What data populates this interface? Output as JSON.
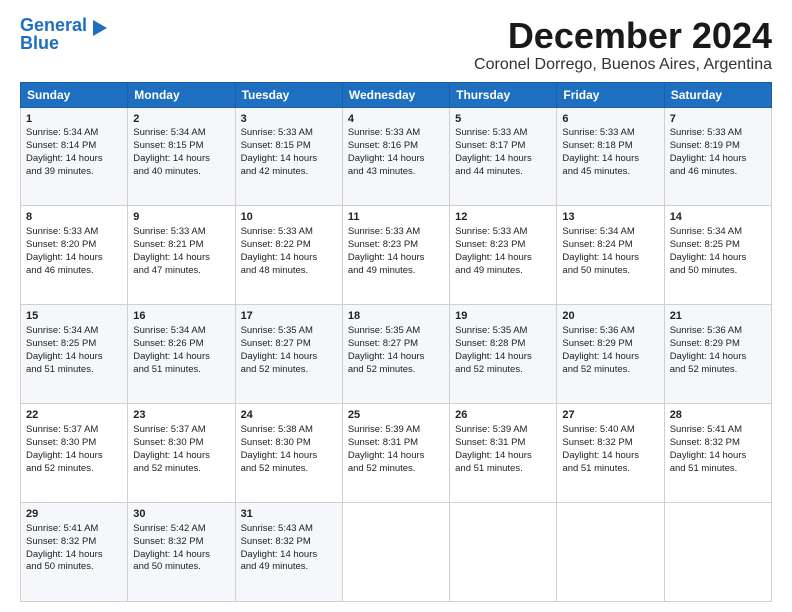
{
  "logo": {
    "line1": "General",
    "line2": "Blue"
  },
  "title": "December 2024",
  "location": "Coronel Dorrego, Buenos Aires, Argentina",
  "weekdays": [
    "Sunday",
    "Monday",
    "Tuesday",
    "Wednesday",
    "Thursday",
    "Friday",
    "Saturday"
  ],
  "weeks": [
    [
      {
        "day": "1",
        "lines": [
          "Sunrise: 5:34 AM",
          "Sunset: 8:14 PM",
          "Daylight: 14 hours",
          "and 39 minutes."
        ]
      },
      {
        "day": "2",
        "lines": [
          "Sunrise: 5:34 AM",
          "Sunset: 8:15 PM",
          "Daylight: 14 hours",
          "and 40 minutes."
        ]
      },
      {
        "day": "3",
        "lines": [
          "Sunrise: 5:33 AM",
          "Sunset: 8:15 PM",
          "Daylight: 14 hours",
          "and 42 minutes."
        ]
      },
      {
        "day": "4",
        "lines": [
          "Sunrise: 5:33 AM",
          "Sunset: 8:16 PM",
          "Daylight: 14 hours",
          "and 43 minutes."
        ]
      },
      {
        "day": "5",
        "lines": [
          "Sunrise: 5:33 AM",
          "Sunset: 8:17 PM",
          "Daylight: 14 hours",
          "and 44 minutes."
        ]
      },
      {
        "day": "6",
        "lines": [
          "Sunrise: 5:33 AM",
          "Sunset: 8:18 PM",
          "Daylight: 14 hours",
          "and 45 minutes."
        ]
      },
      {
        "day": "7",
        "lines": [
          "Sunrise: 5:33 AM",
          "Sunset: 8:19 PM",
          "Daylight: 14 hours",
          "and 46 minutes."
        ]
      }
    ],
    [
      {
        "day": "8",
        "lines": [
          "Sunrise: 5:33 AM",
          "Sunset: 8:20 PM",
          "Daylight: 14 hours",
          "and 46 minutes."
        ]
      },
      {
        "day": "9",
        "lines": [
          "Sunrise: 5:33 AM",
          "Sunset: 8:21 PM",
          "Daylight: 14 hours",
          "and 47 minutes."
        ]
      },
      {
        "day": "10",
        "lines": [
          "Sunrise: 5:33 AM",
          "Sunset: 8:22 PM",
          "Daylight: 14 hours",
          "and 48 minutes."
        ]
      },
      {
        "day": "11",
        "lines": [
          "Sunrise: 5:33 AM",
          "Sunset: 8:23 PM",
          "Daylight: 14 hours",
          "and 49 minutes."
        ]
      },
      {
        "day": "12",
        "lines": [
          "Sunrise: 5:33 AM",
          "Sunset: 8:23 PM",
          "Daylight: 14 hours",
          "and 49 minutes."
        ]
      },
      {
        "day": "13",
        "lines": [
          "Sunrise: 5:34 AM",
          "Sunset: 8:24 PM",
          "Daylight: 14 hours",
          "and 50 minutes."
        ]
      },
      {
        "day": "14",
        "lines": [
          "Sunrise: 5:34 AM",
          "Sunset: 8:25 PM",
          "Daylight: 14 hours",
          "and 50 minutes."
        ]
      }
    ],
    [
      {
        "day": "15",
        "lines": [
          "Sunrise: 5:34 AM",
          "Sunset: 8:25 PM",
          "Daylight: 14 hours",
          "and 51 minutes."
        ]
      },
      {
        "day": "16",
        "lines": [
          "Sunrise: 5:34 AM",
          "Sunset: 8:26 PM",
          "Daylight: 14 hours",
          "and 51 minutes."
        ]
      },
      {
        "day": "17",
        "lines": [
          "Sunrise: 5:35 AM",
          "Sunset: 8:27 PM",
          "Daylight: 14 hours",
          "and 52 minutes."
        ]
      },
      {
        "day": "18",
        "lines": [
          "Sunrise: 5:35 AM",
          "Sunset: 8:27 PM",
          "Daylight: 14 hours",
          "and 52 minutes."
        ]
      },
      {
        "day": "19",
        "lines": [
          "Sunrise: 5:35 AM",
          "Sunset: 8:28 PM",
          "Daylight: 14 hours",
          "and 52 minutes."
        ]
      },
      {
        "day": "20",
        "lines": [
          "Sunrise: 5:36 AM",
          "Sunset: 8:29 PM",
          "Daylight: 14 hours",
          "and 52 minutes."
        ]
      },
      {
        "day": "21",
        "lines": [
          "Sunrise: 5:36 AM",
          "Sunset: 8:29 PM",
          "Daylight: 14 hours",
          "and 52 minutes."
        ]
      }
    ],
    [
      {
        "day": "22",
        "lines": [
          "Sunrise: 5:37 AM",
          "Sunset: 8:30 PM",
          "Daylight: 14 hours",
          "and 52 minutes."
        ]
      },
      {
        "day": "23",
        "lines": [
          "Sunrise: 5:37 AM",
          "Sunset: 8:30 PM",
          "Daylight: 14 hours",
          "and 52 minutes."
        ]
      },
      {
        "day": "24",
        "lines": [
          "Sunrise: 5:38 AM",
          "Sunset: 8:30 PM",
          "Daylight: 14 hours",
          "and 52 minutes."
        ]
      },
      {
        "day": "25",
        "lines": [
          "Sunrise: 5:39 AM",
          "Sunset: 8:31 PM",
          "Daylight: 14 hours",
          "and 52 minutes."
        ]
      },
      {
        "day": "26",
        "lines": [
          "Sunrise: 5:39 AM",
          "Sunset: 8:31 PM",
          "Daylight: 14 hours",
          "and 51 minutes."
        ]
      },
      {
        "day": "27",
        "lines": [
          "Sunrise: 5:40 AM",
          "Sunset: 8:32 PM",
          "Daylight: 14 hours",
          "and 51 minutes."
        ]
      },
      {
        "day": "28",
        "lines": [
          "Sunrise: 5:41 AM",
          "Sunset: 8:32 PM",
          "Daylight: 14 hours",
          "and 51 minutes."
        ]
      }
    ],
    [
      {
        "day": "29",
        "lines": [
          "Sunrise: 5:41 AM",
          "Sunset: 8:32 PM",
          "Daylight: 14 hours",
          "and 50 minutes."
        ]
      },
      {
        "day": "30",
        "lines": [
          "Sunrise: 5:42 AM",
          "Sunset: 8:32 PM",
          "Daylight: 14 hours",
          "and 50 minutes."
        ]
      },
      {
        "day": "31",
        "lines": [
          "Sunrise: 5:43 AM",
          "Sunset: 8:32 PM",
          "Daylight: 14 hours",
          "and 49 minutes."
        ]
      },
      null,
      null,
      null,
      null
    ]
  ]
}
